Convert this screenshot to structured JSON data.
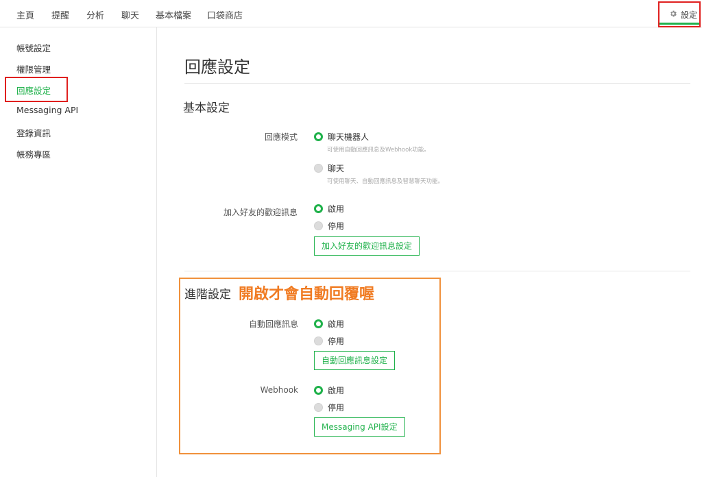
{
  "nav": {
    "items": [
      "主頁",
      "提醒",
      "分析",
      "聊天",
      "基本檔案",
      "口袋商店"
    ],
    "settings_label": "設定"
  },
  "sidebar": {
    "items": [
      "帳號設定",
      "權限管理",
      "回應設定",
      "Messaging API",
      "登錄資訊",
      "帳務專區"
    ],
    "active": "回應設定"
  },
  "main": {
    "title": "回應設定",
    "basic": {
      "title": "基本設定",
      "response_mode": {
        "label": "回應模式",
        "options": [
          {
            "label": "聊天機器人",
            "hint": "可使用自動回應訊息及Webhook功能。",
            "selected": true
          },
          {
            "label": "聊天",
            "hint": "可使用聊天、自動回應訊息及智慧聊天功能。",
            "selected": false
          }
        ]
      },
      "welcome": {
        "label": "加入好友的歡迎訊息",
        "options": [
          {
            "label": "啟用",
            "selected": true
          },
          {
            "label": "停用",
            "selected": false
          }
        ],
        "button": "加入好友的歡迎訊息設定"
      }
    },
    "advanced": {
      "title": "進階設定",
      "annotation": "開啟才會自動回覆喔",
      "auto_reply": {
        "label": "自動回應訊息",
        "options": [
          {
            "label": "啟用",
            "selected": true
          },
          {
            "label": "停用",
            "selected": false
          }
        ],
        "button": "自動回應訊息設定"
      },
      "webhook": {
        "label": "Webhook",
        "options": [
          {
            "label": "啟用",
            "selected": true
          },
          {
            "label": "停用",
            "selected": false
          }
        ],
        "button": "Messaging API設定"
      }
    }
  },
  "colors": {
    "accent": "#21b24c",
    "highlight_red": "#e0201f",
    "annotation_orange": "#f07b22"
  }
}
